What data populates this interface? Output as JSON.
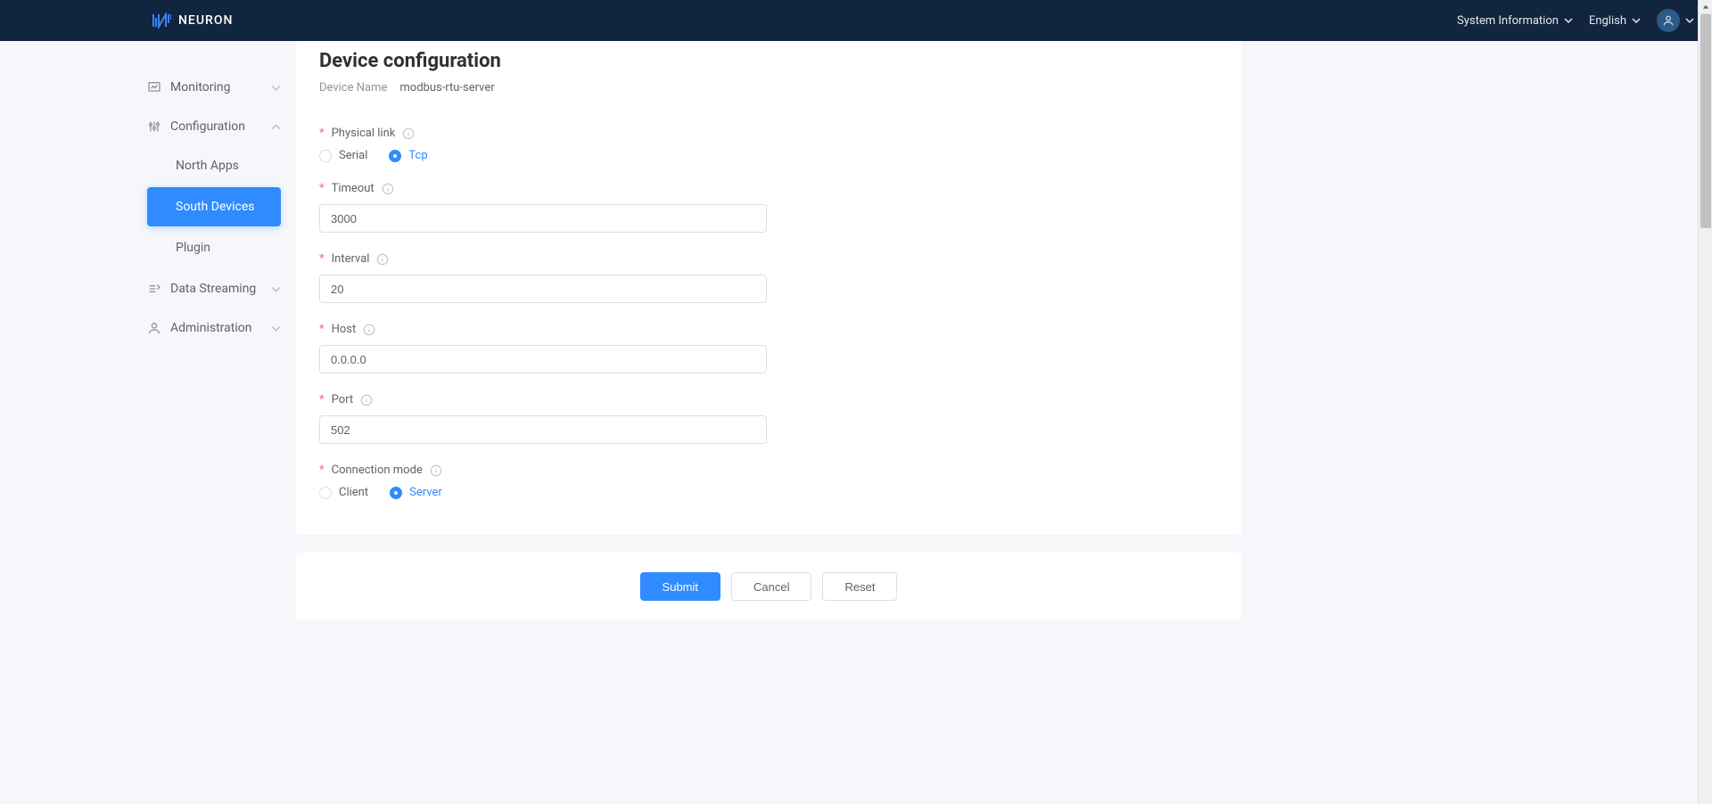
{
  "brand": "NEURON",
  "topbar": {
    "system_info": "System Information",
    "language": "English"
  },
  "sidebar": {
    "monitoring": "Monitoring",
    "configuration": "Configuration",
    "config_children": {
      "north_apps": "North Apps",
      "south_devices": "South Devices",
      "plugin": "Plugin"
    },
    "data_streaming": "Data Streaming",
    "administration": "Administration"
  },
  "page": {
    "title": "Device configuration",
    "device_name_label": "Device Name",
    "device_name_value": "modbus-rtu-server"
  },
  "form": {
    "physical_link": {
      "label": "Physical link",
      "options": {
        "serial": "Serial",
        "tcp": "Tcp"
      }
    },
    "timeout": {
      "label": "Timeout",
      "value": "3000"
    },
    "interval": {
      "label": "Interval",
      "value": "20"
    },
    "host": {
      "label": "Host",
      "value": "0.0.0.0"
    },
    "port": {
      "label": "Port",
      "value": "502"
    },
    "connection_mode": {
      "label": "Connection mode",
      "options": {
        "client": "Client",
        "server": "Server"
      }
    }
  },
  "footer": {
    "submit": "Submit",
    "cancel": "Cancel",
    "reset": "Reset"
  }
}
